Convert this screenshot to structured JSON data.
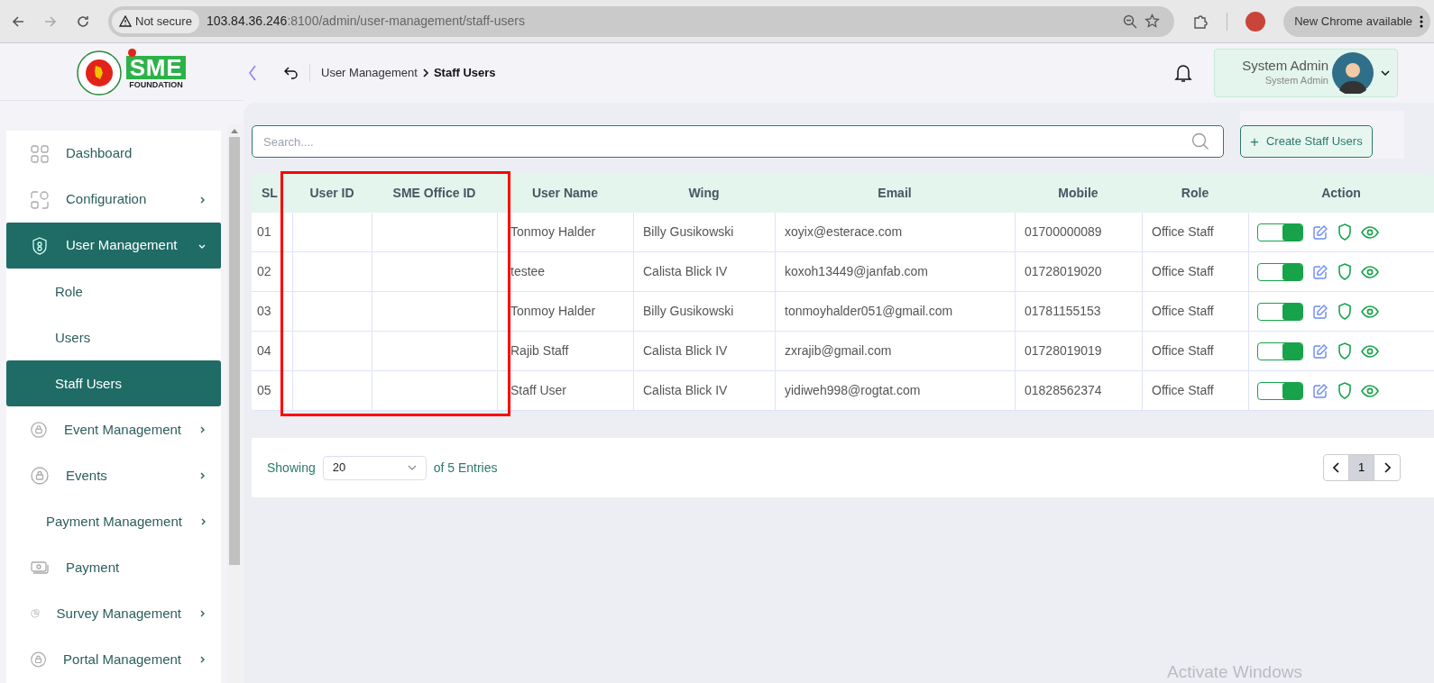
{
  "browser": {
    "security": "Not secure",
    "url_host": "103.84.36.246",
    "url_path": ":8100/admin/user-management/staff-users",
    "update": "New Chrome available"
  },
  "logo": {
    "brand": "SME",
    "subtitle": "FOUNDATION"
  },
  "breadcrumb": {
    "parent": "User Management",
    "current": "Staff Users"
  },
  "user": {
    "name": "System Admin",
    "role": "System Admin"
  },
  "sidebar": {
    "items": [
      {
        "label": "Dashboard",
        "selected": false,
        "arrow": false
      },
      {
        "label": "Configuration",
        "selected": false,
        "arrow": true,
        "expanded": false
      },
      {
        "label": "User Management",
        "selected": true,
        "arrow": true,
        "expanded": true,
        "children": [
          {
            "label": "Role",
            "selected": false
          },
          {
            "label": "Users",
            "selected": false
          },
          {
            "label": "Staff Users",
            "selected": true
          }
        ]
      },
      {
        "label": "Event Management",
        "selected": false,
        "arrow": true,
        "expanded": false
      },
      {
        "label": "Events",
        "selected": false,
        "arrow": true,
        "expanded": false
      },
      {
        "label": "Payment Management",
        "selected": false,
        "arrow": true,
        "expanded": false
      },
      {
        "label": "Payment",
        "selected": false,
        "arrow": false
      },
      {
        "label": "Survey Management",
        "selected": false,
        "arrow": true,
        "expanded": false
      },
      {
        "label": "Portal Management",
        "selected": false,
        "arrow": true,
        "expanded": false
      }
    ]
  },
  "search": {
    "placeholder": "Search...."
  },
  "create_button": {
    "icon": "+",
    "label": "Create Staff Users"
  },
  "table": {
    "columns": [
      "SL",
      "User ID",
      "SME Office ID",
      "User Name",
      "Wing",
      "Email",
      "Mobile",
      "Role",
      "Action"
    ],
    "rows": [
      {
        "sl": "01",
        "user_id": "",
        "office_id": "",
        "name": "Tonmoy Halder",
        "wing": "Billy Gusikowski",
        "email": "xoyix@esterace.com",
        "mobile": "01700000089",
        "role": "Office Staff",
        "active": true
      },
      {
        "sl": "02",
        "user_id": "",
        "office_id": "",
        "name": "testee",
        "wing": "Calista Blick IV",
        "email": "koxoh13449@janfab.com",
        "mobile": "01728019020",
        "role": "Office Staff",
        "active": true
      },
      {
        "sl": "03",
        "user_id": "",
        "office_id": "",
        "name": "Tonmoy Halder",
        "wing": "Billy Gusikowski",
        "email": "tonmoyhalder051@gmail.com",
        "mobile": "01781155153",
        "role": "Office Staff",
        "active": true
      },
      {
        "sl": "04",
        "user_id": "",
        "office_id": "",
        "name": "Rajib Staff",
        "wing": "Calista Blick IV",
        "email": "zxrajib@gmail.com",
        "mobile": "01728019019",
        "role": "Office Staff",
        "active": true
      },
      {
        "sl": "05",
        "user_id": "",
        "office_id": "",
        "name": "Staff User",
        "wing": "Calista Blick IV",
        "email": "yidiweh998@rogtat.com",
        "mobile": "01828562374",
        "role": "Office Staff",
        "active": true
      }
    ]
  },
  "pagination": {
    "showing": "Showing",
    "page_size": "20",
    "of_entries": "of 5 Entries",
    "pages": [
      {
        "label": "1",
        "selected": true
      }
    ]
  },
  "highlight_box": true,
  "os_overlay": "Activate Windows"
}
